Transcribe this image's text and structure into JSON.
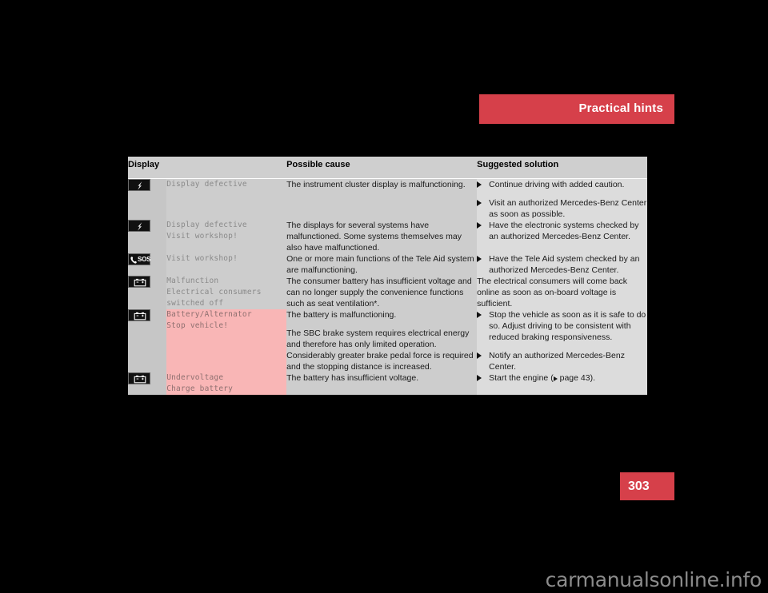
{
  "header": {
    "title": "Practical hints",
    "accent_color": "#d6404a"
  },
  "page": {
    "number": "303",
    "watermark": "carmanualsonline.info",
    "background_color": "#000000"
  },
  "table": {
    "columns": [
      "Display",
      "Possible cause",
      "Suggested solution"
    ],
    "rows": [
      {
        "icon": "lightning-bolt-icon",
        "display_lines": [
          "Display defective"
        ],
        "display_warning": false,
        "cause_paragraphs": [
          "The instrument cluster display is malfunctioning."
        ],
        "solution_type": "bullets",
        "solution_items": [
          "Continue driving with added caution.",
          "Visit an authorized Mercedes-Benz Center as soon as possible."
        ]
      },
      {
        "icon": "lightning-bolt-icon",
        "display_lines": [
          "Display defective",
          "Visit workshop!"
        ],
        "display_warning": false,
        "cause_paragraphs": [
          "The displays for several systems have malfunctioned. Some systems themselves may also have malfunctioned."
        ],
        "solution_type": "bullets",
        "solution_items": [
          "Have the electronic systems checked by an authorized Mercedes-Benz Center."
        ]
      },
      {
        "icon": "phone-sos-icon",
        "display_lines": [
          "Visit workshop!"
        ],
        "display_warning": false,
        "cause_paragraphs": [
          "One or more main functions of the Tele Aid system are malfunctioning."
        ],
        "solution_type": "bullets",
        "solution_items": [
          "Have the Tele Aid system checked by an authorized Mercedes-Benz Center."
        ]
      },
      {
        "icon": "battery-icon",
        "display_lines": [
          "Malfunction",
          "Electrical consumers",
          "switched off"
        ],
        "display_warning": false,
        "cause_paragraphs": [
          "The consumer battery has insufficient voltage and can no longer supply the convenience functions such as seat ventilation*."
        ],
        "solution_type": "plain",
        "solution_paragraphs": [
          "The electrical consumers will come back online as soon as on-board voltage is sufficient."
        ]
      },
      {
        "icon": "battery-icon",
        "display_lines": [
          "Battery/Alternator",
          "Stop vehicle!"
        ],
        "display_warning": true,
        "cause_paragraphs": [
          "The battery is malfunctioning.",
          "The SBC brake system requires electrical energy and therefore has only limited operation. Considerably greater brake pedal force is required and the stopping distance is increased."
        ],
        "solution_type": "bullets",
        "solution_items": [
          "Stop the vehicle as soon as it is safe to do so. Adjust driving to be consistent with reduced braking responsiveness.",
          "Notify an authorized Mercedes-Benz Center."
        ]
      },
      {
        "icon": "battery-icon",
        "display_lines": [
          "Undervoltage",
          "Charge battery"
        ],
        "display_warning": true,
        "cause_paragraphs": [
          "The battery has insufficient voltage."
        ],
        "solution_type": "bullets-pageref",
        "solution_items": [
          "Start the engine ("
        ],
        "solution_pageref": " page 43).",
        "solution_pageref_prefix": "Start the engine ("
      }
    ],
    "warning_cell_color": "#f9b6b6"
  }
}
